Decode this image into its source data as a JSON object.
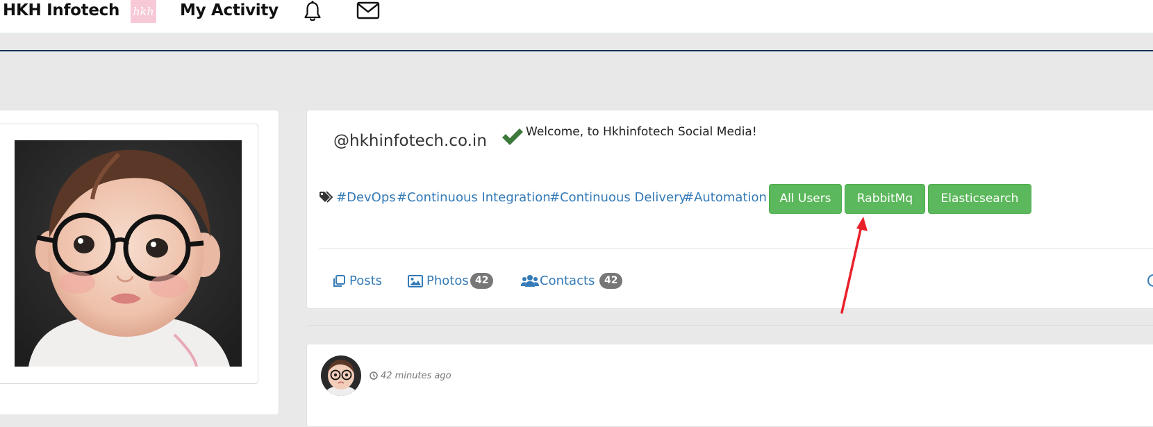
{
  "navbar": {
    "brand": "HKH Infotech",
    "logo_text": "hkh",
    "activity": "My Activity",
    "icons": [
      "bell-icon",
      "envelope-icon"
    ]
  },
  "profile": {
    "handle": "@hkhinfotech.co.in",
    "welcome": "Welcome, to Hkhinfotech Social Media!",
    "tags": [
      "#DevOps",
      "#Continuous Integration",
      "#Continuous Delivery",
      "#Automation"
    ],
    "buttons": [
      "All Users",
      "RabbitMq",
      "Elasticsearch"
    ]
  },
  "tabs": {
    "posts": {
      "label": "Posts"
    },
    "photos": {
      "label": "Photos",
      "count": "42"
    },
    "contacts": {
      "label": "Contacts",
      "count": "42"
    }
  },
  "post": {
    "time": "42 minutes ago"
  },
  "colors": {
    "link": "#337ab7",
    "button_green": "#5cb85c",
    "badge_gray": "#777777",
    "nav_rule": "#0e2f58",
    "verified_green": "#3c7a3c",
    "annotation_red": "#e8202a"
  }
}
